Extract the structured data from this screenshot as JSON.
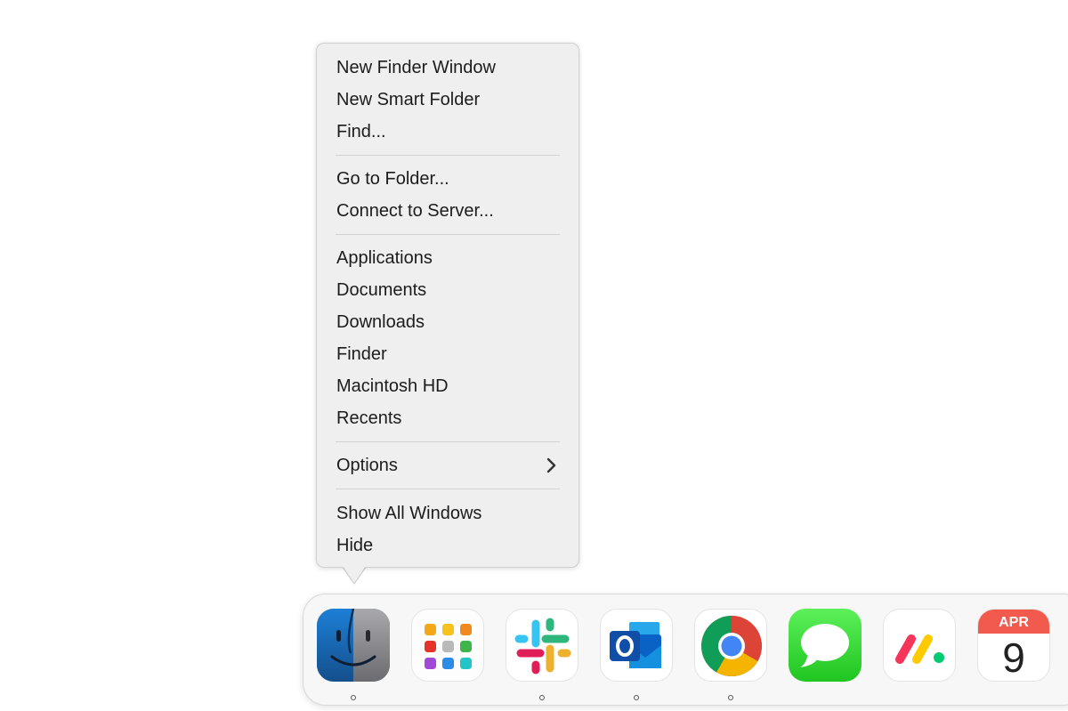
{
  "menu": {
    "items": [
      {
        "label": "New Finder Window"
      },
      {
        "label": "New Smart Folder"
      },
      {
        "label": "Find..."
      },
      {
        "label": "Go to Folder..."
      },
      {
        "label": "Connect to Server..."
      },
      {
        "label": "Applications"
      },
      {
        "label": "Documents"
      },
      {
        "label": "Downloads"
      },
      {
        "label": "Finder"
      },
      {
        "label": "Macintosh HD"
      },
      {
        "label": "Recents"
      },
      {
        "label": "Options",
        "has_submenu": true
      },
      {
        "label": "Show All Windows"
      },
      {
        "label": "Hide"
      }
    ]
  },
  "dock": {
    "apps": [
      {
        "name": "Finder",
        "icon": "finder-icon",
        "running": true
      },
      {
        "name": "Launchpad",
        "icon": "launchpad-icon",
        "running": false
      },
      {
        "name": "Slack",
        "icon": "slack-icon",
        "running": true
      },
      {
        "name": "Outlook",
        "icon": "outlook-icon",
        "running": true
      },
      {
        "name": "Chrome",
        "icon": "chrome-icon",
        "running": true
      },
      {
        "name": "Messages",
        "icon": "messages-icon",
        "running": false
      },
      {
        "name": "monday.com",
        "icon": "monday-icon",
        "running": false
      },
      {
        "name": "Calendar",
        "icon": "calendar-icon",
        "running": false
      }
    ],
    "calendar": {
      "month": "APR",
      "day": "9"
    }
  },
  "colors": {
    "menu_bg": "#efefef",
    "calendar_red": "#f25a4e",
    "messages_green": "#2fd22f"
  }
}
